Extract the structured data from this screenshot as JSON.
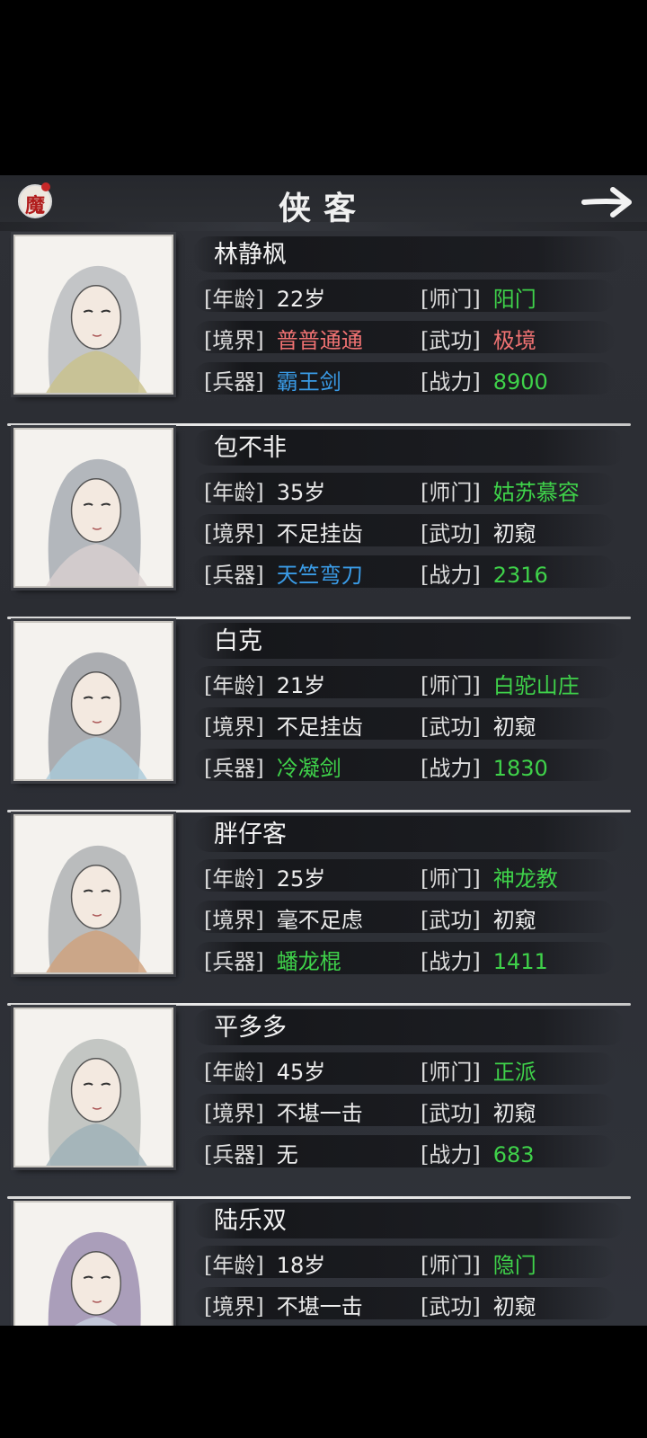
{
  "header": {
    "title": "侠客",
    "logo_char": "魔",
    "logo_icon": "mo-seal-icon",
    "next_icon": "arrow-right-icon"
  },
  "labels": {
    "age": "[年龄]",
    "realm": "[境界]",
    "weapon": "[兵器]",
    "sect": "[师门]",
    "kungfu": "[武功]",
    "power": "[战力]"
  },
  "heroes": [
    {
      "name": "林静枫",
      "age": "22岁",
      "realm": "普普通通",
      "realm_color": "#f07272",
      "weapon": "霸王剑",
      "weapon_color": "#3a9be6",
      "sect": "阳门",
      "kungfu": "极境",
      "kungfu_color": "#f07272",
      "power": "8900"
    },
    {
      "name": "包不非",
      "age": "35岁",
      "realm": "不足挂齿",
      "realm_color": "#eeeeee",
      "weapon": "天竺弯刀",
      "weapon_color": "#3a9be6",
      "sect": "姑苏慕容",
      "kungfu": "初窥",
      "kungfu_color": "#eeeeee",
      "power": "2316"
    },
    {
      "name": "白克",
      "age": "21岁",
      "realm": "不足挂齿",
      "realm_color": "#eeeeee",
      "weapon": "冷凝剑",
      "weapon_color": "#3fd24a",
      "sect": "白驼山庄",
      "kungfu": "初窥",
      "kungfu_color": "#eeeeee",
      "power": "1830"
    },
    {
      "name": "胖仔客",
      "age": "25岁",
      "realm": "毫不足虑",
      "realm_color": "#eeeeee",
      "weapon": "蟠龙棍",
      "weapon_color": "#3fd24a",
      "sect": "神龙教",
      "kungfu": "初窥",
      "kungfu_color": "#eeeeee",
      "power": "1411"
    },
    {
      "name": "平多多",
      "age": "45岁",
      "realm": "不堪一击",
      "realm_color": "#eeeeee",
      "weapon": "无",
      "weapon_color": "#eeeeee",
      "sect": "正派",
      "kungfu": "初窥",
      "kungfu_color": "#eeeeee",
      "power": "683"
    },
    {
      "name": "陆乐双",
      "age": "18岁",
      "realm": "不堪一击",
      "realm_color": "#eeeeee",
      "weapon": "",
      "weapon_color": "#eeeeee",
      "sect": "隐门",
      "kungfu": "初窥",
      "kungfu_color": "#eeeeee",
      "power": ""
    }
  ],
  "colors": {
    "green": "#3fd24a",
    "blue": "#3a9be6",
    "red": "#f07272",
    "white": "#eeeeee",
    "background": "#2e3036"
  }
}
